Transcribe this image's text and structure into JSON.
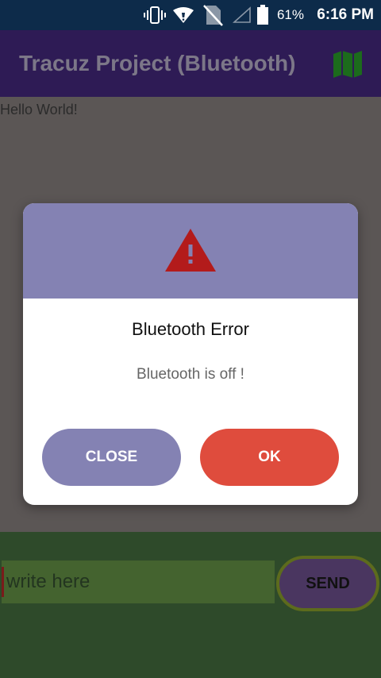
{
  "status_bar": {
    "battery_percent": "61%",
    "time": "6:16 PM",
    "icons": [
      "vibrate-icon",
      "wifi-icon",
      "no-sim-icon",
      "signal-icon",
      "battery-icon"
    ]
  },
  "app_bar": {
    "title": "Tracuz Project (Bluetooth)",
    "action_icon": "map-icon"
  },
  "content": {
    "hello_text": "Hello World!"
  },
  "dialog": {
    "icon": "warning-icon",
    "title": "Bluetooth Error",
    "message": "Bluetooth is off !",
    "close_label": "CLOSE",
    "ok_label": "OK"
  },
  "composer": {
    "placeholder": "write here",
    "value": "",
    "send_label": "SEND"
  },
  "colors": {
    "status_bar": "#0d2b4a",
    "app_bar": "#2e1b55",
    "dialog_header": "#8482b3",
    "ok_button": "#df4c3d",
    "warning_icon": "#b31b1b",
    "bottom_panel": "#2e4a2a"
  }
}
